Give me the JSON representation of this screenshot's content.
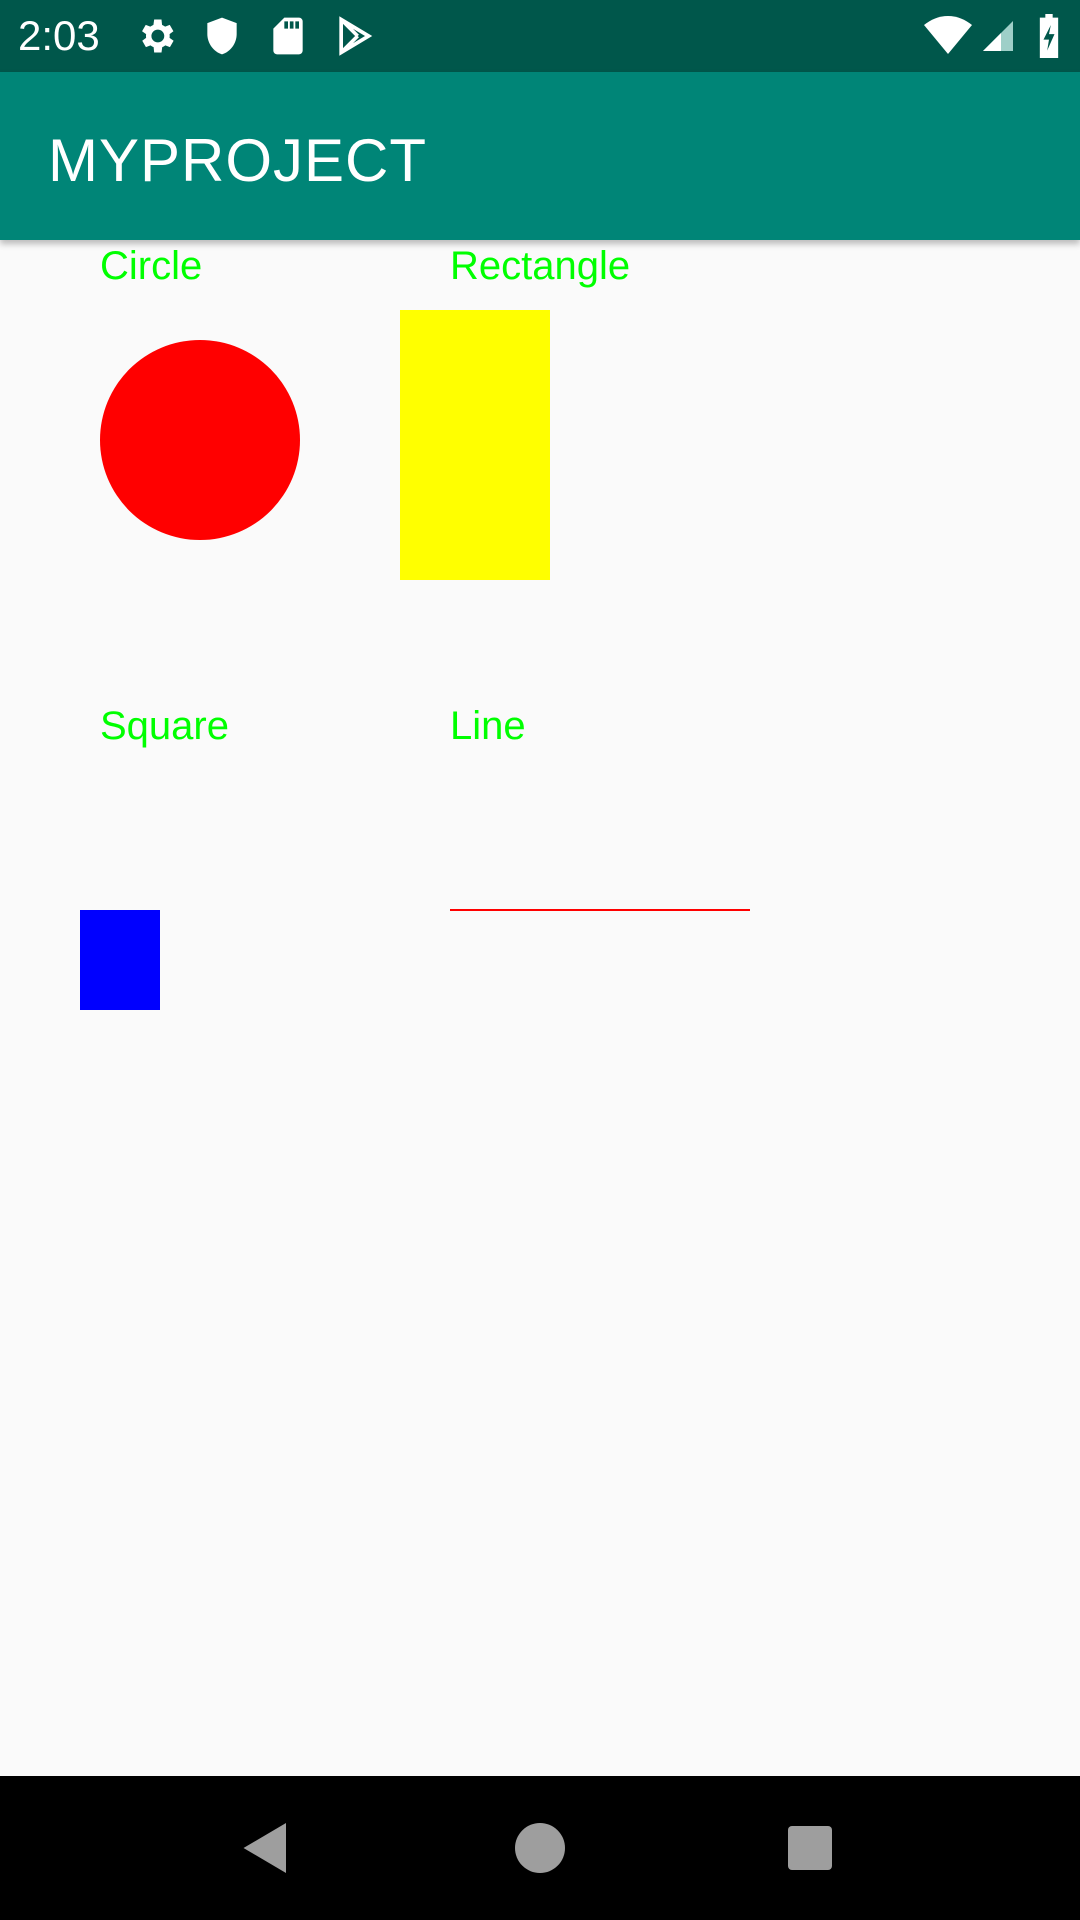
{
  "status_bar": {
    "time": "2:03",
    "left_icons": [
      "gear-icon",
      "shield-icon",
      "sd-card-icon",
      "play-store-icon"
    ],
    "right_icons": [
      "wifi-icon",
      "signal-icon",
      "battery-charging-icon"
    ]
  },
  "app_bar": {
    "title": "MYPROJECT",
    "color": "#008577"
  },
  "shapes": {
    "circle": {
      "label": "Circle",
      "color": "#ff0000"
    },
    "rectangle": {
      "label": "Rectangle",
      "color": "#ffff00"
    },
    "square": {
      "label": "Square",
      "color": "#0000ff"
    },
    "line": {
      "label": "Line",
      "color": "#ff0000"
    },
    "label_color": "#00ff00"
  },
  "nav_bar": {
    "buttons": [
      "back-icon",
      "home-icon",
      "recents-icon"
    ]
  }
}
